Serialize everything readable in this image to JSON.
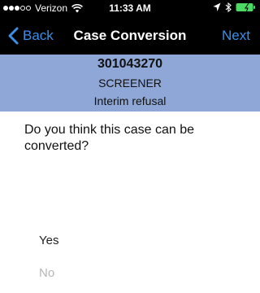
{
  "status_bar": {
    "carrier": "Verizon",
    "time": "11:33 AM",
    "signal_bars_full": 3,
    "signal_bars_total": 5,
    "icons": [
      "signal-icon",
      "wifi-icon",
      "location-icon",
      "bluetooth-icon",
      "battery-icon"
    ]
  },
  "nav": {
    "back_label": "Back",
    "title": "Case Conversion",
    "next_label": "Next"
  },
  "case": {
    "id": "301043270",
    "type": "SCREENER",
    "status": "Interim refusal"
  },
  "question": "Do you think this case can be converted?",
  "options": [
    {
      "label": "Yes"
    },
    {
      "label": "No"
    }
  ],
  "colors": {
    "bar_background": "#000000",
    "accent": "#3b8fe8",
    "header_background": "#8ea7d6",
    "battery": "#4cd964",
    "disabled_text": "#b5b5b5"
  }
}
